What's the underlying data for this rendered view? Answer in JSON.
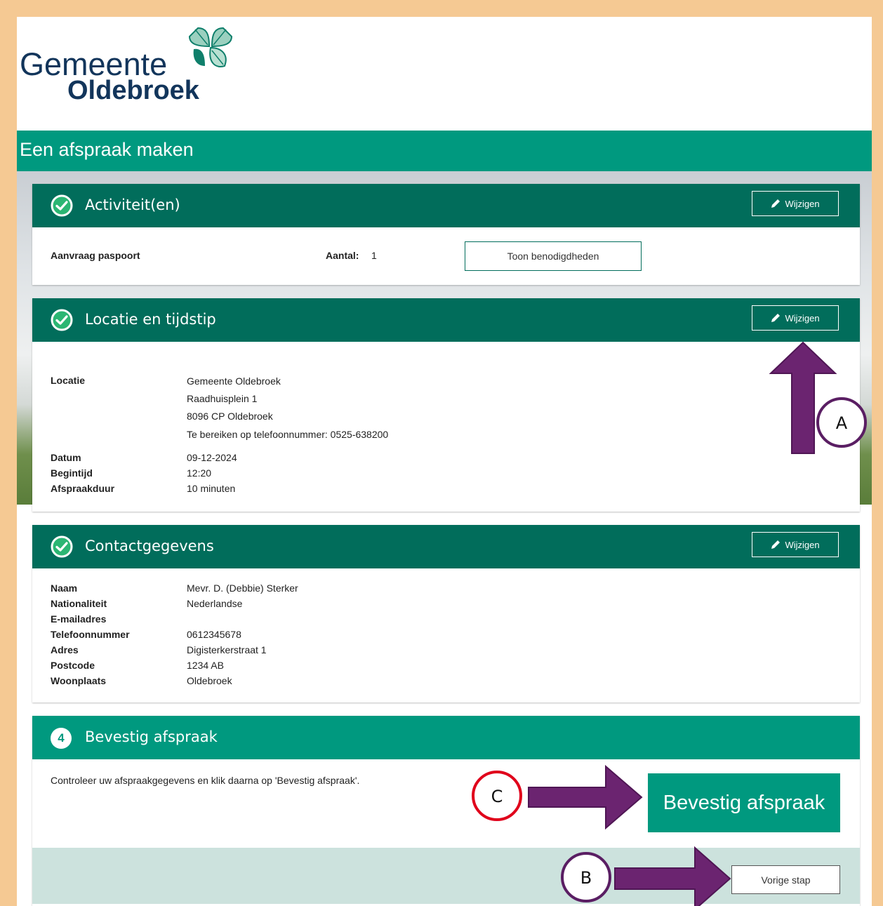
{
  "logo": {
    "line1": "Gemeente",
    "line2": "Oldebroek"
  },
  "page_title": "Een afspraak maken",
  "edit_label": "Wijzigen",
  "activities": {
    "title": "Activiteit(en)",
    "item": "Aanvraag paspoort",
    "count_label": "Aantal:",
    "count_value": "1",
    "show_button": "Toon benodigdheden"
  },
  "location": {
    "title": "Locatie en tijdstip",
    "location_label": "Locatie",
    "address_lines": [
      "Gemeente Oldebroek",
      "Raadhuisplein 1",
      "8096 CP Oldebroek",
      "Te bereiken op telefoonnummer: 0525-638200"
    ],
    "date_label": "Datum",
    "date_value": "09-12-2024",
    "start_label": "Begintijd",
    "start_value": "12:20",
    "duration_label": "Afspraakduur",
    "duration_value": "10 minuten"
  },
  "contact": {
    "title": "Contactgegevens",
    "rows": [
      {
        "label": "Naam",
        "value": "Mevr. D. (Debbie) Sterker"
      },
      {
        "label": "Nationaliteit",
        "value": "Nederlandse"
      },
      {
        "label": "E-mailadres",
        "value": ""
      },
      {
        "label": "Telefoonnummer",
        "value": "0612345678"
      },
      {
        "label": "Adres",
        "value": "Digisterkerstraat 1"
      },
      {
        "label": "Postcode",
        "value": "1234 AB"
      },
      {
        "label": "Woonplaats",
        "value": "Oldebroek"
      }
    ]
  },
  "confirm": {
    "step": "4",
    "title": "Bevestig afspraak",
    "instruction": "Controleer uw afspraakgegevens en klik daarna op 'Bevestig afspraak'.",
    "confirm_button": "Bevestig afspraak",
    "back_button": "Vorige stap"
  },
  "annotations": {
    "a": "A",
    "b": "B",
    "c": "C"
  },
  "colors": {
    "frame": "#f5c993",
    "brand": "#00997f",
    "header_dark": "#016d5b",
    "arrow": "#6b2470",
    "circle_c": "#e0001b"
  }
}
